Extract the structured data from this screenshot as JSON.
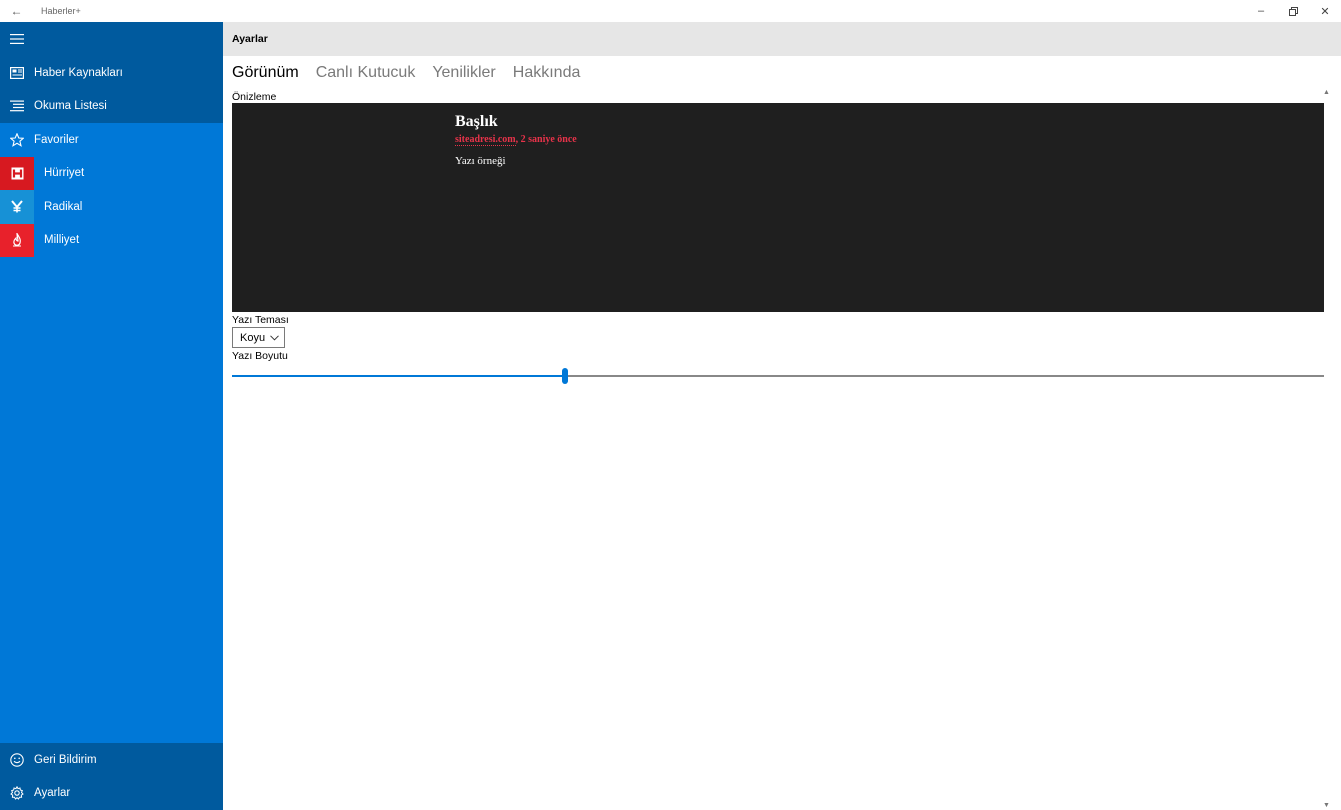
{
  "window": {
    "title": "Haberler+",
    "back_icon": "arrow-left-icon",
    "controls": [
      "minimize-icon",
      "restore-icon",
      "close-icon"
    ]
  },
  "sidebar": {
    "top_items": [
      {
        "label": "Haber Kaynakları",
        "icon": "newspaper-icon"
      },
      {
        "label": "Okuma Listesi",
        "icon": "list-icon"
      }
    ],
    "favorites": {
      "label": "Favoriler",
      "icon": "star-icon"
    },
    "sources": [
      {
        "label": "Hürriyet",
        "icon": "hurriyet-logo-icon",
        "color": "#d71920"
      },
      {
        "label": "Radikal",
        "icon": "radikal-logo-icon",
        "color": "#1791d6"
      },
      {
        "label": "Milliyet",
        "icon": "milliyet-logo-icon",
        "color": "#e8212b"
      }
    ],
    "bottom_items": [
      {
        "label": "Geri Bildirim",
        "icon": "smiley-icon"
      },
      {
        "label": "Ayarlar",
        "icon": "gear-icon"
      }
    ]
  },
  "main": {
    "header": "Ayarlar",
    "tabs": [
      {
        "label": "Görünüm",
        "active": true
      },
      {
        "label": "Canlı Kutucuk",
        "active": false
      },
      {
        "label": "Yenilikler",
        "active": false
      },
      {
        "label": "Hakkında",
        "active": false
      }
    ],
    "preview_label": "Önizleme",
    "preview": {
      "title": "Başlık",
      "site": "siteadresi.com",
      "time": ", 2 saniye önce",
      "body": "Yazı örneği"
    },
    "theme_label": "Yazı Teması",
    "theme_value": "Koyu",
    "size_label": "Yazı Boyutu",
    "size_fraction": 0.304
  },
  "colors": {
    "accent": "#0078d7",
    "sidebar_dark": "#005a9e",
    "preview_bg": "#1f1f1f",
    "preview_meta": "#e8334a"
  }
}
